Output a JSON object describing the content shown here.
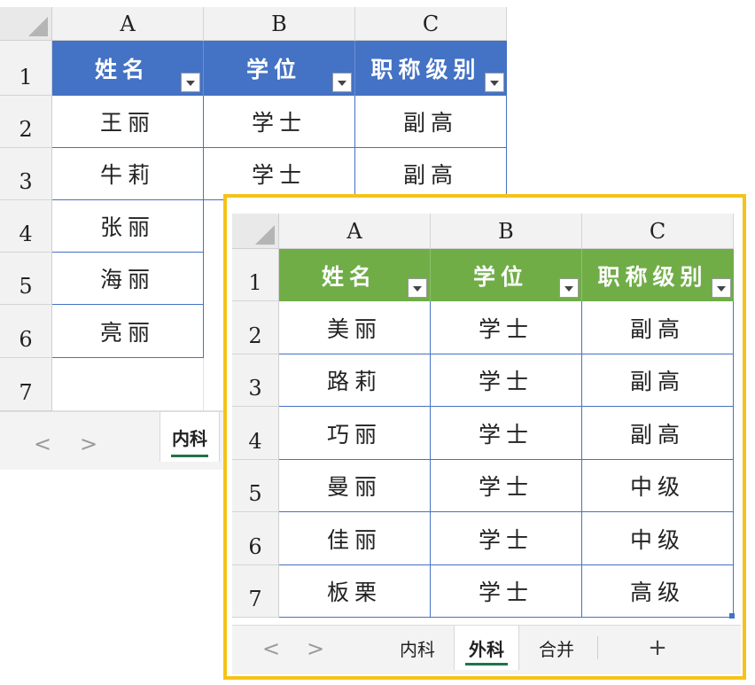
{
  "back_sheet": {
    "col_headers": [
      "A",
      "B",
      "C"
    ],
    "row_headers": [
      "1",
      "2",
      "3",
      "4",
      "5",
      "6",
      "7"
    ],
    "header_row": [
      "姓名",
      "学位",
      "职称级别"
    ],
    "header_color": "#4472c4",
    "rows": [
      [
        "王丽",
        "学士",
        "副高"
      ],
      [
        "牛莉",
        "学士",
        "副高"
      ],
      [
        "张丽",
        "",
        ""
      ],
      [
        "海丽",
        "",
        ""
      ],
      [
        "亮丽",
        "",
        ""
      ]
    ],
    "tabs": [
      "内科"
    ],
    "active_tab": "内科",
    "nav_prev": "<",
    "nav_next": ">"
  },
  "front_sheet": {
    "col_headers": [
      "A",
      "B",
      "C"
    ],
    "row_headers": [
      "1",
      "2",
      "3",
      "4",
      "5",
      "6",
      "7"
    ],
    "header_row": [
      "姓名",
      "学位",
      "职称级别"
    ],
    "header_color": "#70ad47",
    "rows": [
      [
        "美丽",
        "学士",
        "副高"
      ],
      [
        "路莉",
        "学士",
        "副高"
      ],
      [
        "巧丽",
        "学士",
        "副高"
      ],
      [
        "曼丽",
        "学士",
        "中级"
      ],
      [
        "佳丽",
        "学士",
        "中级"
      ],
      [
        "板栗",
        "学士",
        "高级"
      ]
    ],
    "tabs": [
      "内科",
      "外科",
      "合并"
    ],
    "active_tab": "外科",
    "add_tab": "+",
    "nav_prev": "<",
    "nav_next": ">"
  },
  "highlight_color": "#f4c31a",
  "icons": [
    "select-all-corner-icon",
    "filter-dropdown-icon",
    "nav-prev-icon",
    "nav-next-icon",
    "add-sheet-icon"
  ]
}
